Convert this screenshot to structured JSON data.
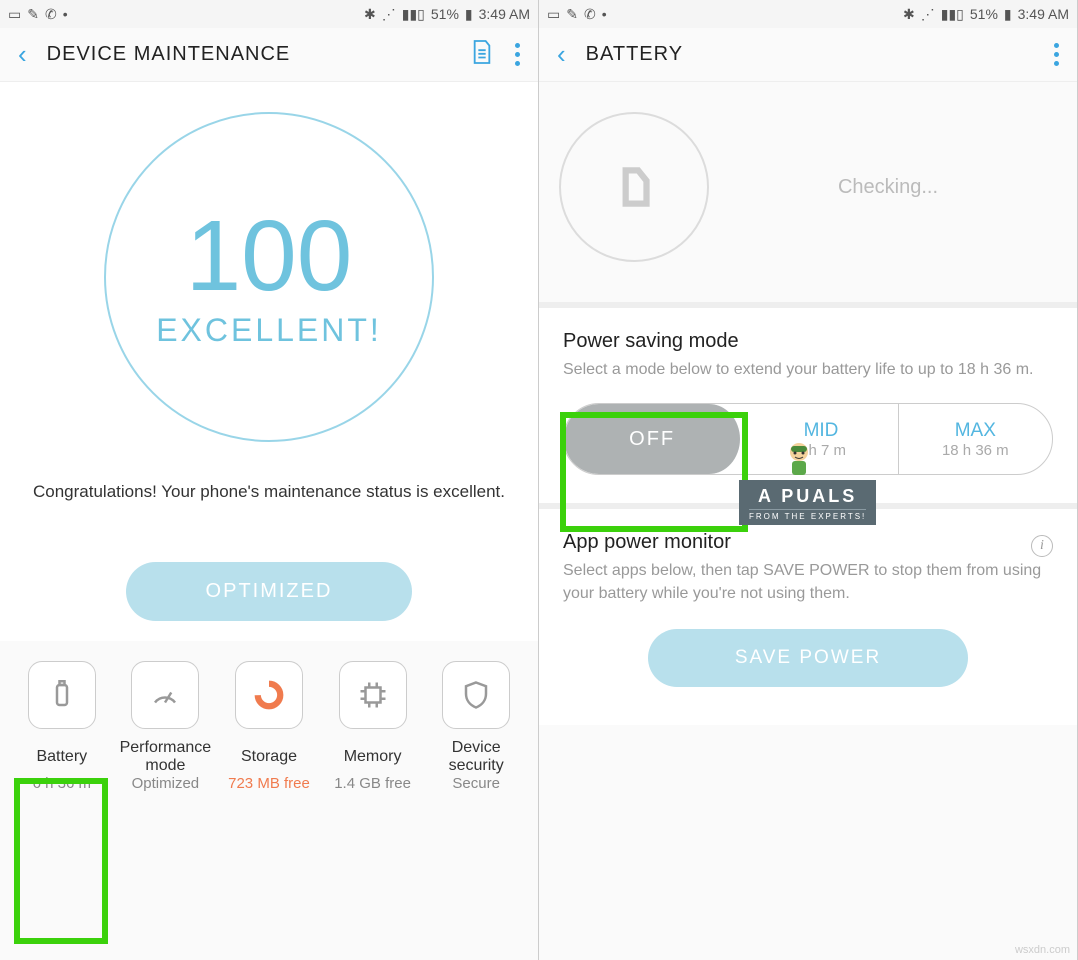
{
  "status": {
    "battery_pct": "51%",
    "time": "3:49 AM"
  },
  "left": {
    "title": "DEVICE MAINTENANCE",
    "score": "100",
    "grade": "EXCELLENT!",
    "congrats": "Congratulations! Your phone's maintenance status is excellent.",
    "optimized": "OPTIMIZED",
    "bottom": [
      {
        "label": "Battery",
        "sub": "6 h 36 m"
      },
      {
        "label": "Performance mode",
        "sub": "Optimized"
      },
      {
        "label": "Storage",
        "sub": "723 MB free"
      },
      {
        "label": "Memory",
        "sub": "1.4 GB free"
      },
      {
        "label": "Device security",
        "sub": "Secure"
      }
    ]
  },
  "right": {
    "title": "BATTERY",
    "checking": "Checking...",
    "psm": {
      "heading": "Power saving mode",
      "desc": "Select a mode below to extend your battery life to up to 18 h 36 m.",
      "off": "OFF",
      "mid": "MID",
      "mid_est": "8 h 7 m",
      "max": "MAX",
      "max_est": "18 h 36 m"
    },
    "apm": {
      "heading": "App power monitor",
      "desc": "Select apps below, then tap SAVE POWER to stop them from using your battery while you're not using them.",
      "button": "SAVE POWER"
    }
  },
  "overlay": {
    "brand_top": "A   PUALS",
    "brand_bot": "FROM THE EXPERTS!"
  },
  "watermark": "wsxdn.com"
}
